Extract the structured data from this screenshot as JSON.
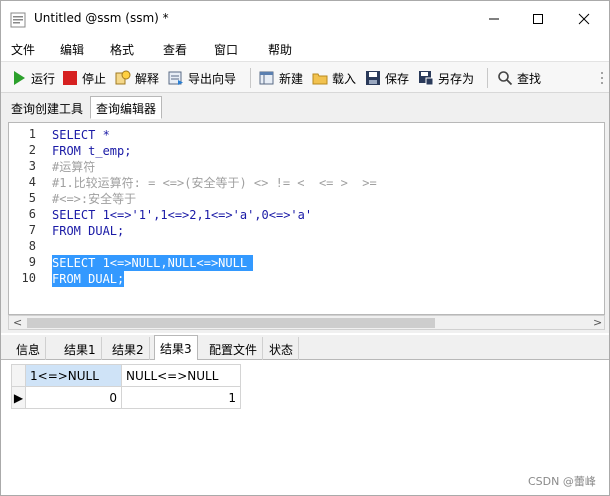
{
  "window": {
    "title": "Untitled @ssm (ssm) *",
    "controls": {
      "minimize": "—",
      "maximize": "☐",
      "close": "✕"
    }
  },
  "menu": [
    "文件",
    "编辑",
    "格式",
    "查看",
    "窗口",
    "帮助"
  ],
  "toolbar": {
    "run": "运行",
    "stop": "停止",
    "explain": "解释",
    "export_wizard": "导出向导",
    "new": "新建",
    "load": "载入",
    "save": "保存",
    "save_as": "另存为",
    "find": "查找"
  },
  "top_tabs": [
    "查询创建工具",
    "查询编辑器"
  ],
  "active_top_tab": "查询编辑器",
  "editor": {
    "line_numbers": [
      "1",
      "2",
      "3",
      "4",
      "5",
      "6",
      "7",
      "8",
      "9",
      "10"
    ],
    "lines": [
      "SELECT *",
      "FROM t_emp;",
      "#运算符",
      "#1.比较运算符: = <=>(安全等于) <> != <  <= >  >=",
      "#<=>:安全等于",
      "SELECT 1<=>'1',1<=>2,1<=>'a',0<=>'a'",
      "FROM DUAL;",
      "",
      "SELECT 1<=>NULL,NULL<=>NULL",
      "FROM DUAL;"
    ],
    "selected_lines": [
      9,
      10
    ]
  },
  "bottom_tabs": [
    "信息",
    "结果1",
    "结果2",
    "结果3",
    "配置文件",
    "状态"
  ],
  "active_bottom_tab": "结果3",
  "result_grid": {
    "columns": [
      "1<=>NULL",
      "NULL<=>NULL"
    ],
    "rows": [
      [
        "0",
        "1"
      ]
    ],
    "row_marker": "▶"
  },
  "watermark": "CSDN @蕾峰",
  "colors": {
    "keyword": "#1a1aa6",
    "string": "#a31515",
    "comment": "#a0a0a0",
    "selection": "#3399ff",
    "run_icon": "#2ca02c",
    "stop_icon": "#d62020"
  }
}
